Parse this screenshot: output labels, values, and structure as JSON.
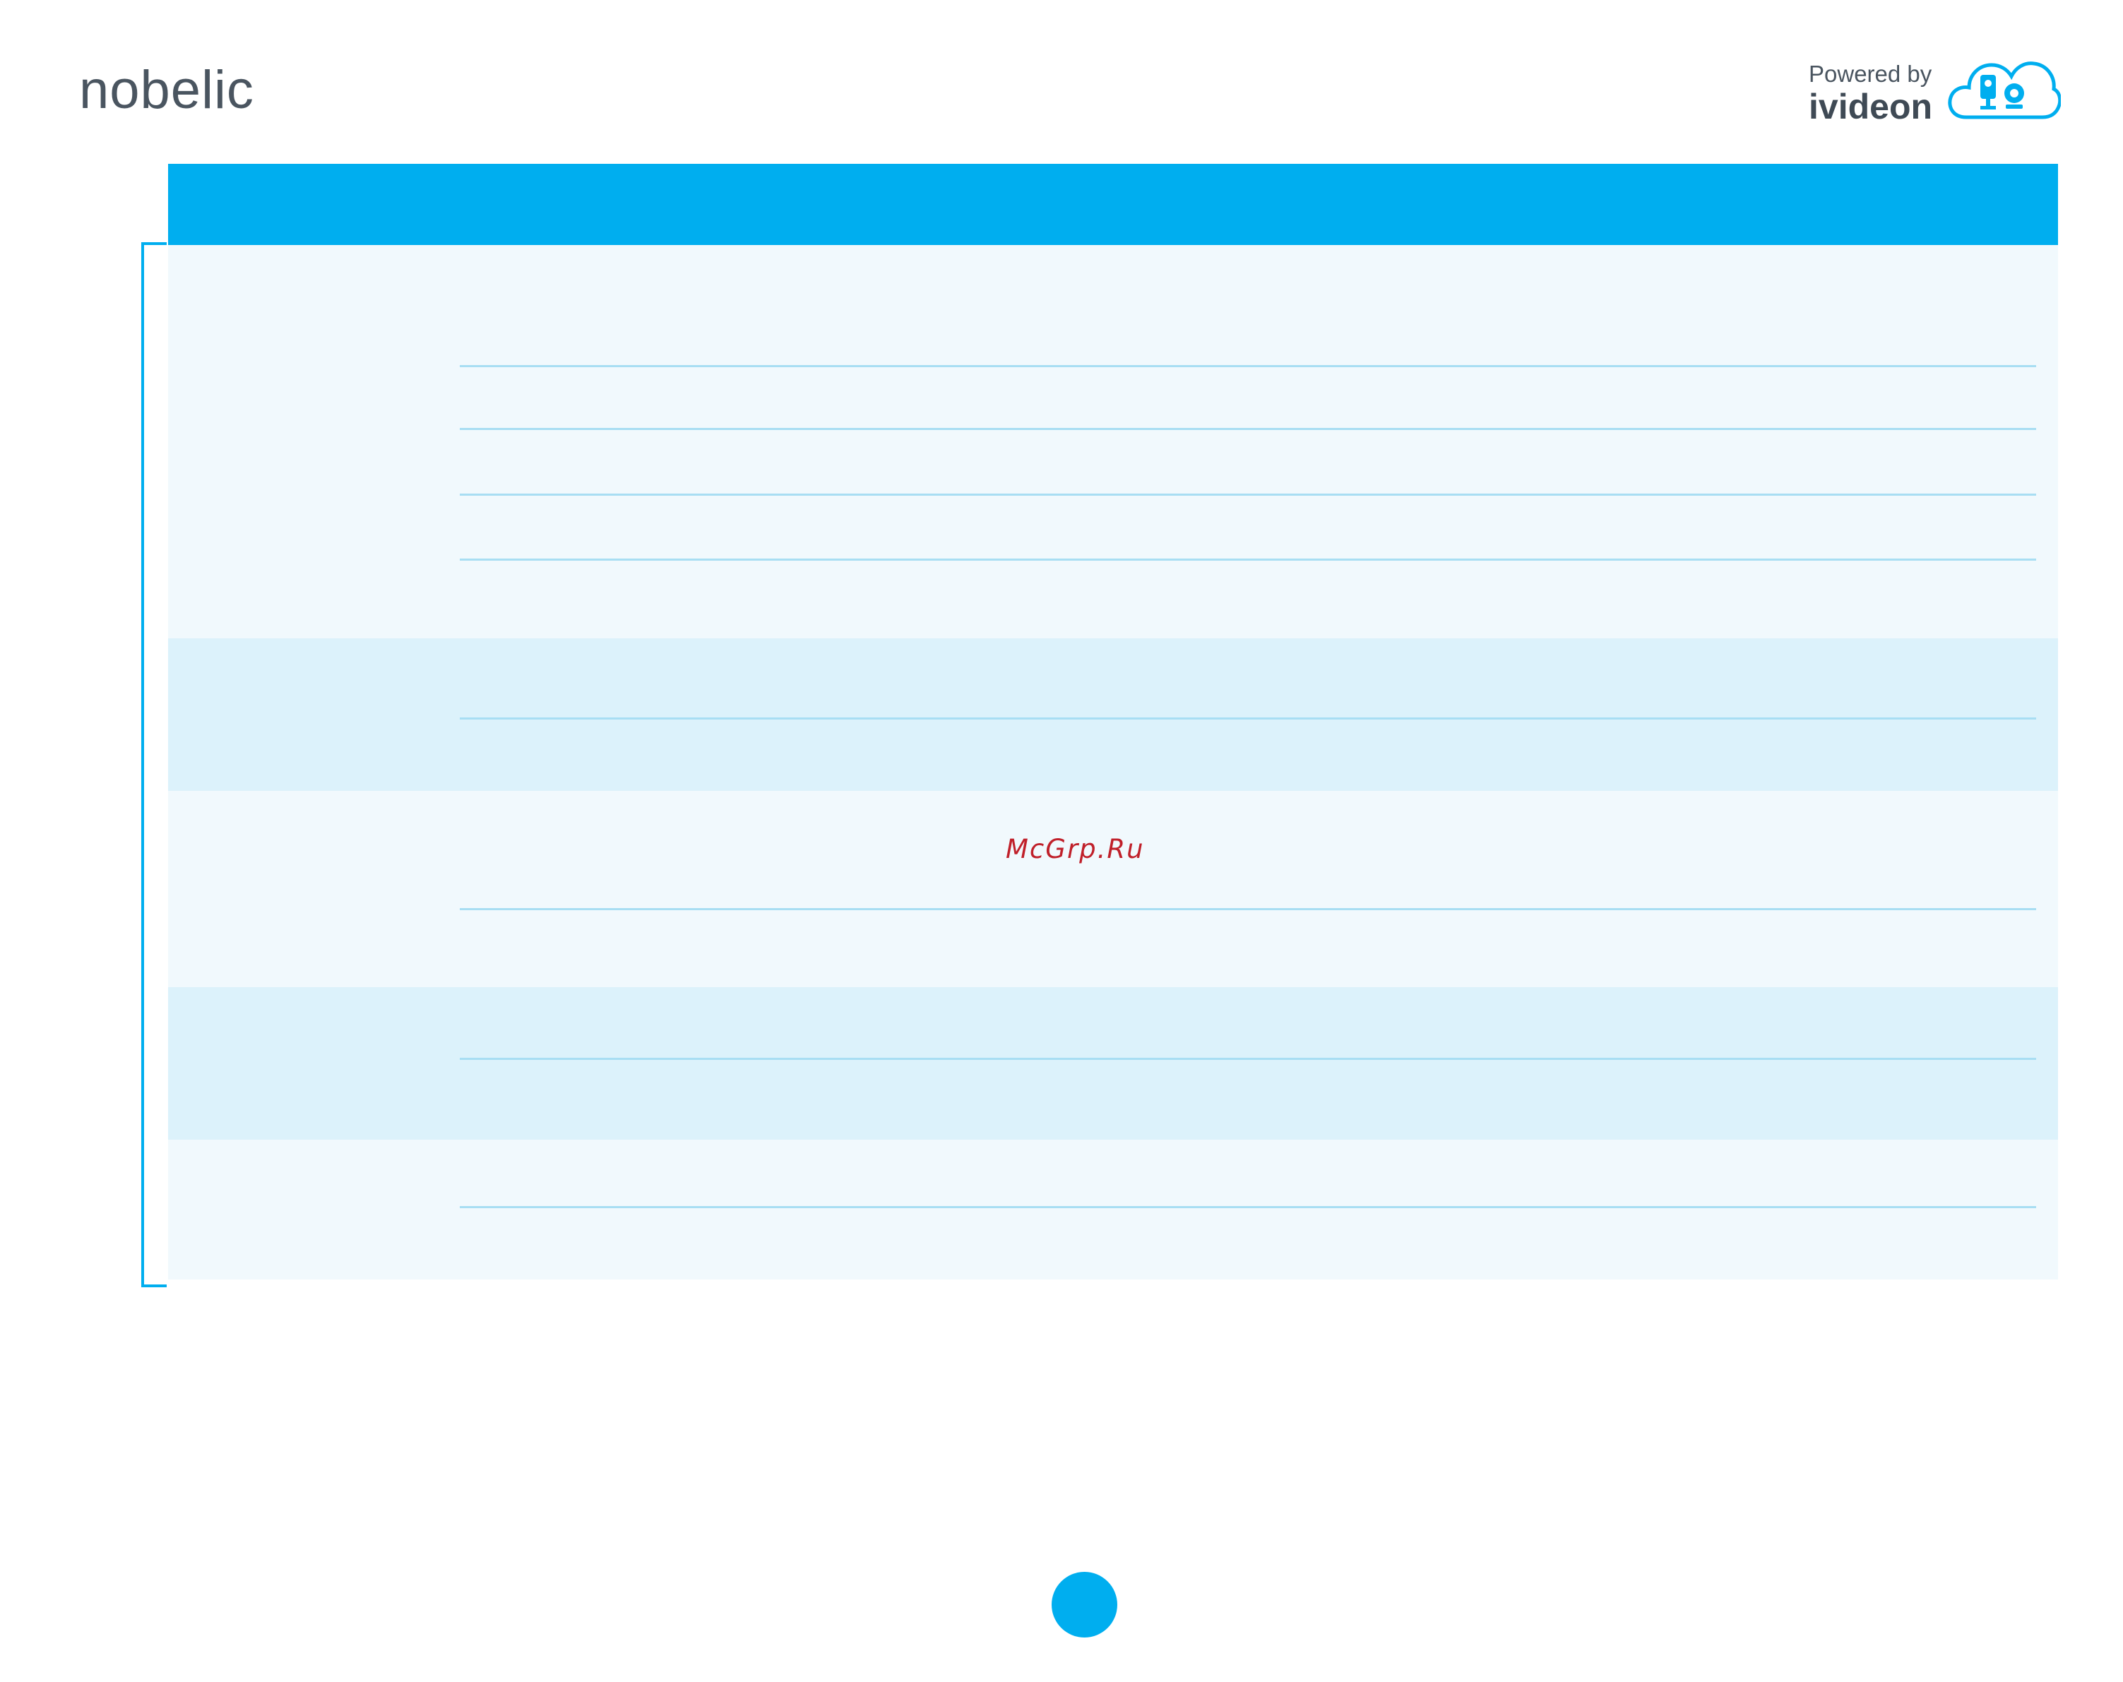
{
  "header": {
    "brand_logo": "nobelic",
    "powered_by_label": "Powered by",
    "powered_by_brand": "ivideon",
    "cloud_icon": "cloud-camera-icon"
  },
  "table": {
    "header_color": "#00aeef",
    "row_colors": [
      "#f1f9fd",
      "#dcf2fb"
    ],
    "rule_color": "#a8def3",
    "sections": [
      {
        "rows": 5
      },
      {
        "rows": 2
      },
      {
        "rows": 2
      },
      {
        "rows": 2
      },
      {
        "rows": 2
      }
    ]
  },
  "watermark": "McGrp.Ru",
  "page_marker_color": "#00aeef"
}
